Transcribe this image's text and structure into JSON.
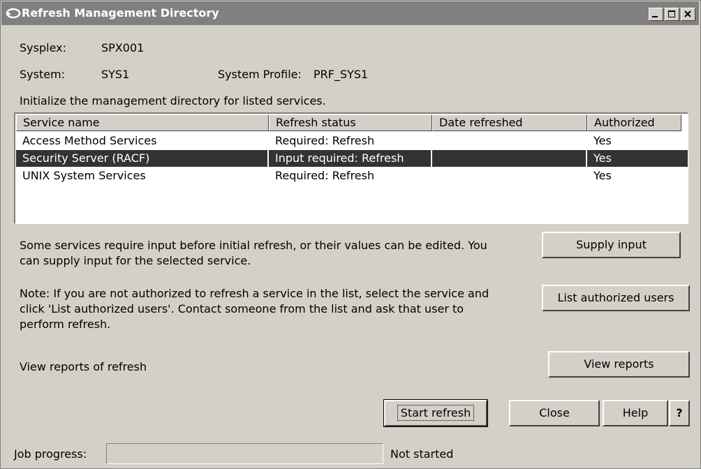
{
  "window": {
    "title": "Refresh Management Directory"
  },
  "info": {
    "sysplex_label": "Sysplex:",
    "sysplex_value": "SPX001",
    "system_label": "System:",
    "system_value": "SYS1",
    "profile_label": "System Profile:",
    "profile_value": "PRF_SYS1"
  },
  "table": {
    "caption": "Initialize the management directory for listed services.",
    "columns": [
      "Service name",
      "Refresh status",
      "Date refreshed",
      "Authorized"
    ],
    "rows": [
      {
        "service": "Access Method Services",
        "status": "Required: Refresh",
        "date": "",
        "authorized": "Yes",
        "selected": false
      },
      {
        "service": "Security Server (RACF)",
        "status": "Input required: Refresh",
        "date": "",
        "authorized": "Yes",
        "selected": true
      },
      {
        "service": "UNIX System Services",
        "status": "Required: Refresh",
        "date": "",
        "authorized": "Yes",
        "selected": false
      }
    ]
  },
  "supply": {
    "text": "Some services require input before initial refresh, or their values can be edited. You can supply input for the selected service.",
    "button": "Supply input"
  },
  "authorized": {
    "text": "Note: If you are not authorized to refresh a service in the list, select the service and click 'List authorized users'. Contact someone from the list and ask that user to perform refresh.",
    "button": "List authorized users"
  },
  "reports": {
    "text": "View reports of refresh",
    "button": "View reports"
  },
  "actions": {
    "start": "Start refresh",
    "close": "Close",
    "help": "Help",
    "question": "?"
  },
  "progress": {
    "label": "Job progress:",
    "status": "Not started",
    "value": 0
  },
  "colors": {
    "face": "#d4d0c8",
    "titlebar": "#808080",
    "selection": "#333333"
  }
}
